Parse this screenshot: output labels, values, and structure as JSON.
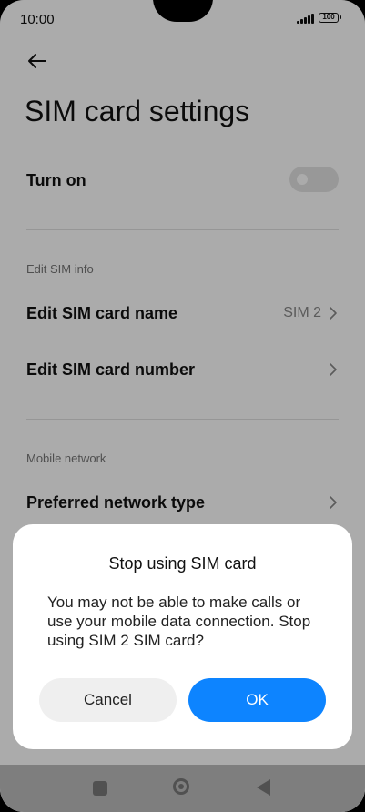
{
  "status_bar": {
    "time": "10:00",
    "battery": "100"
  },
  "page": {
    "title": "SIM card settings"
  },
  "settings": {
    "turn_on_label": "Turn on",
    "section_edit": "Edit SIM info",
    "edit_name_label": "Edit SIM card name",
    "edit_name_value": "SIM 2",
    "edit_number_label": "Edit SIM card number",
    "section_mobile": "Mobile network",
    "network_type_label": "Preferred network type"
  },
  "dialog": {
    "title": "Stop using SIM card",
    "message": "You may not be able to make calls or use your mobile data connection. Stop using SIM 2 SIM card?",
    "cancel_label": "Cancel",
    "ok_label": "OK"
  },
  "colors": {
    "accent": "#0d84ff"
  },
  "icons": {
    "back": "back-arrow-icon",
    "chevron": "chevron-right-icon",
    "signal": "signal-icon",
    "battery": "battery-icon"
  }
}
